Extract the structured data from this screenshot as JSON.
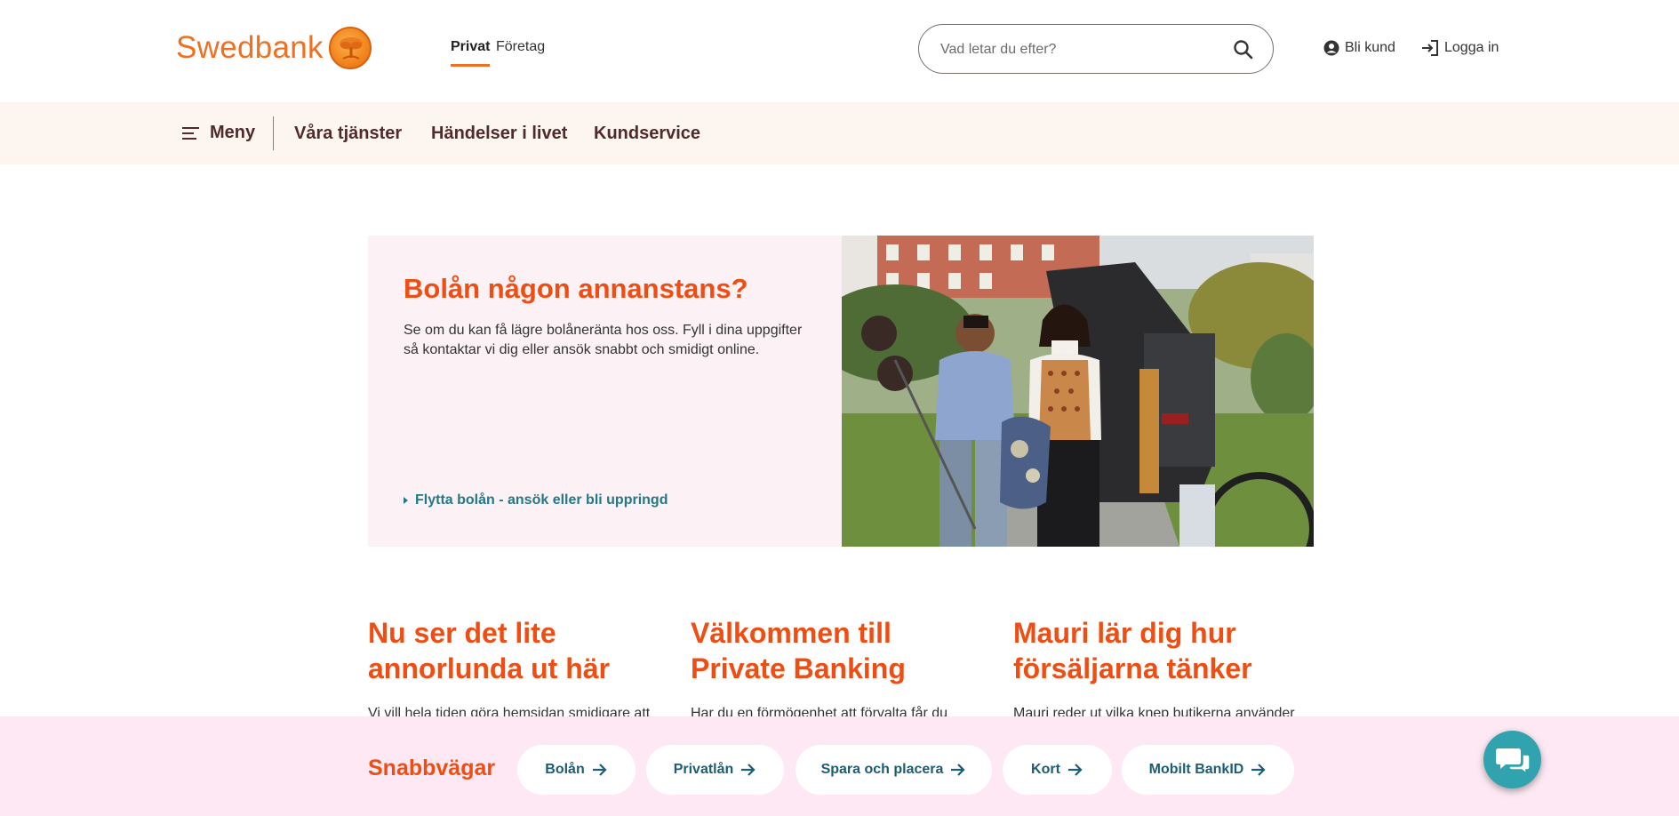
{
  "header": {
    "brand": "Swedbank",
    "segments": {
      "privat": "Privat",
      "foretag": "Företag"
    },
    "search": {
      "placeholder": "Vad letar du efter?"
    },
    "links": {
      "bli_kund": "Bli kund",
      "logga_in": "Logga in"
    },
    "icons": {
      "search": "search-icon",
      "user": "user-circle-icon",
      "login": "login-icon"
    }
  },
  "nav": {
    "menu_label": "Meny",
    "items": [
      "Våra tjänster",
      "Händelser i livet",
      "Kundservice"
    ]
  },
  "hero": {
    "title": "Bolån någon annanstans?",
    "description": "Se om du kan få lägre bolåneränta hos oss. Fyll i dina uppgifter så kontaktar vi dig eller ansök snabbt och smidigt online.",
    "link": "Flytta bolån - ansök eller bli uppringd"
  },
  "cards": [
    {
      "title": "Nu ser det lite annorlunda ut här",
      "text": "Vi vill hela tiden göra hemsidan smidigare att"
    },
    {
      "title": "Välkommen till Private Banking",
      "text": "Har du en förmögenhet att förvalta får du"
    },
    {
      "title": "Mauri lär dig hur försäljarna tänker",
      "text": "Mauri reder ut vilka knep butikerna använder"
    }
  ],
  "quicklinks": {
    "title": "Snabbvägar",
    "items": [
      "Bolån",
      "Privatlån",
      "Spara och placera",
      "Kort",
      "Mobilt BankID"
    ]
  },
  "colors": {
    "brand_orange": "#ee7023",
    "heading_orange": "#ee4e14",
    "link_teal": "#257886",
    "nav_bg": "#fdf5f0",
    "hero_bg": "#fcf1f4",
    "quickbar_bg": "#fde8f3",
    "chat_teal": "#31a3ae"
  }
}
